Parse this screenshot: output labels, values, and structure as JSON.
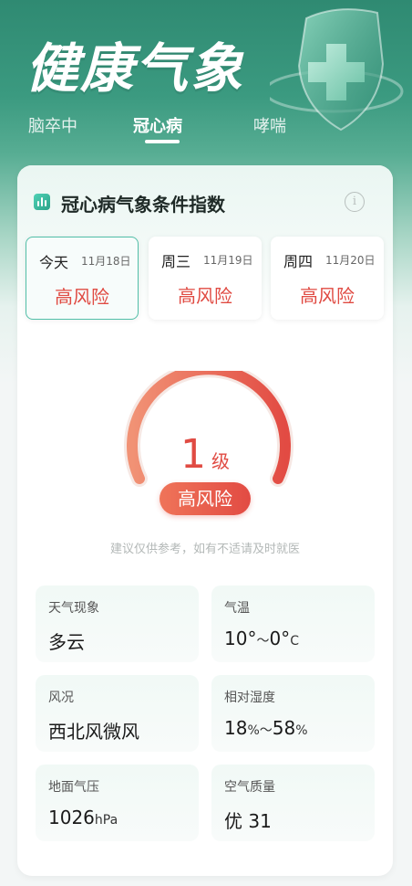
{
  "header": {
    "title": "健康气象",
    "tabs": [
      "脑卒中",
      "冠心病",
      "哮喘"
    ],
    "active_tab": "冠心病"
  },
  "card": {
    "title": "冠心病气象条件指数",
    "info_icon": "info-icon",
    "days": [
      {
        "name": "今天",
        "date": "11月18日",
        "risk": "高风险",
        "selected": true
      },
      {
        "name": "周三",
        "date": "11月19日",
        "risk": "高风险",
        "selected": false
      },
      {
        "name": "周四",
        "date": "11月20日",
        "risk": "高风险",
        "selected": false
      }
    ],
    "gauge": {
      "level": "1",
      "unit": "级",
      "risk": "高风险",
      "color_start": "#f08a6c",
      "color_end": "#e24b43"
    },
    "advice": "建议仅供参考，如有不适请及时就医",
    "stats": {
      "weather": {
        "label": "天气现象",
        "value": "多云"
      },
      "temperature": {
        "label": "气温",
        "high": "10°",
        "sep": "～",
        "low": "0°",
        "unit": "C"
      },
      "wind": {
        "label": "风况",
        "value": "西北风微风"
      },
      "humidity": {
        "label": "相对湿度",
        "low": "18",
        "sep": "～",
        "high": "58",
        "unit": "%"
      },
      "pressure": {
        "label": "地面气压",
        "value": "1026",
        "unit": "hPa"
      },
      "air": {
        "label": "空气质量",
        "value": "优 31"
      }
    }
  },
  "colors": {
    "brand": "#3b9a80",
    "risk": "#e04b43",
    "accent_border": "#52bfa8"
  }
}
